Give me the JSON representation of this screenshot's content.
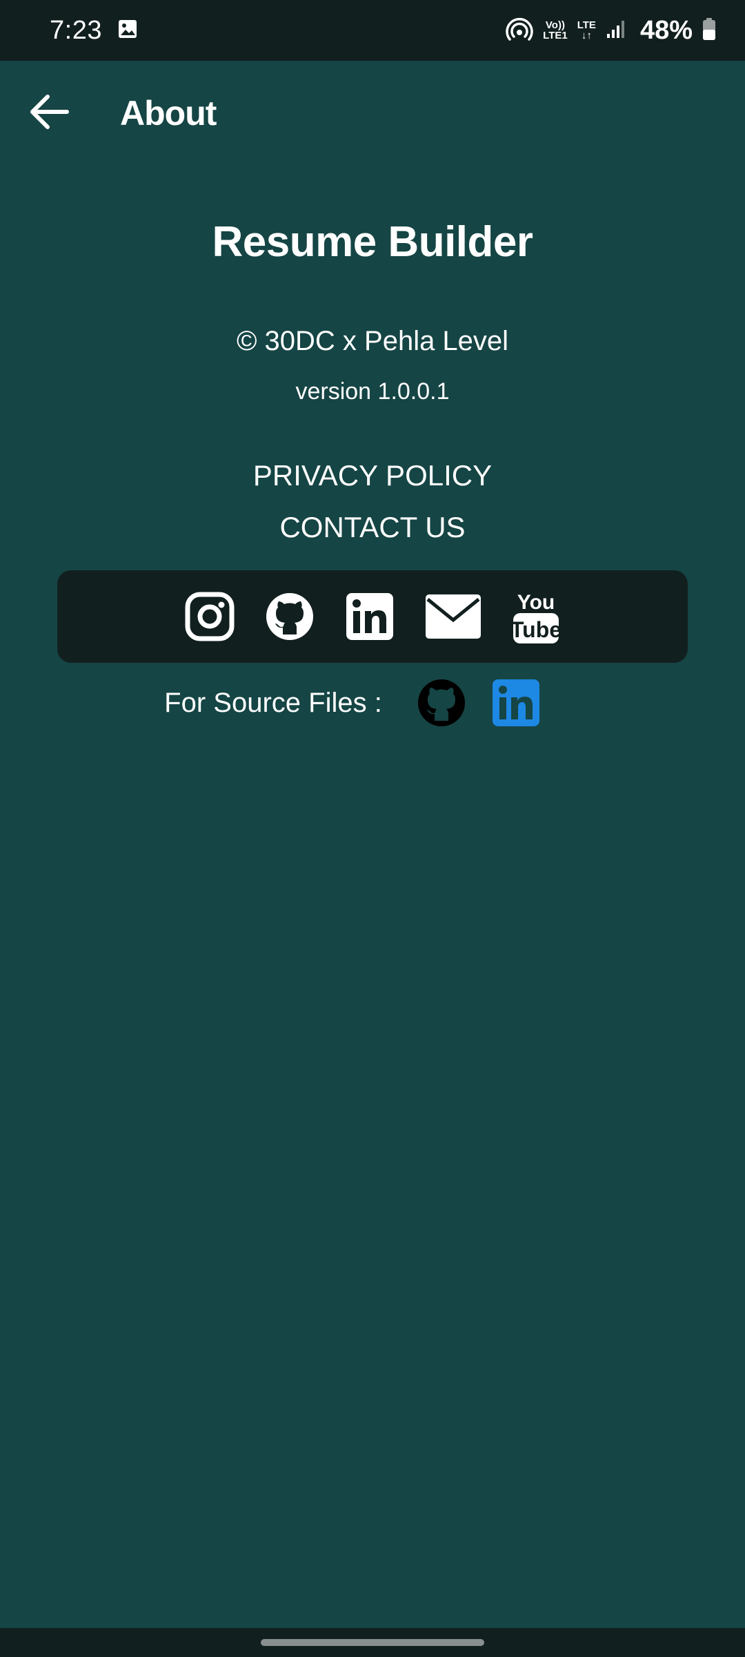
{
  "status_bar": {
    "time": "7:23",
    "network_top": "Vo))",
    "network_bottom": "LTE1",
    "lte_label": "LTE",
    "battery": "48%",
    "icons": [
      "gallery-icon",
      "hotspot-icon",
      "volte-icon",
      "lte-icon",
      "signal-icon",
      "battery-icon"
    ]
  },
  "app_bar": {
    "title": "About"
  },
  "about": {
    "app_name": "Resume Builder",
    "copyright": "© 30DC x Pehla Level",
    "version": "version 1.0.0.1",
    "privacy_policy": "PRIVACY POLICY",
    "contact_us": "CONTACT US"
  },
  "social": {
    "icons": [
      "instagram-icon",
      "github-icon",
      "linkedin-icon",
      "email-icon",
      "youtube-icon"
    ],
    "youtube_top": "You",
    "youtube_bottom": "Tube"
  },
  "source_files": {
    "label": "For Source Files :",
    "icons": [
      "github-icon",
      "linkedin-icon"
    ]
  },
  "colors": {
    "background": "#154544",
    "bar": "#121f1f",
    "text": "#ffffff",
    "linkedin_blue": "#1e88e5"
  }
}
